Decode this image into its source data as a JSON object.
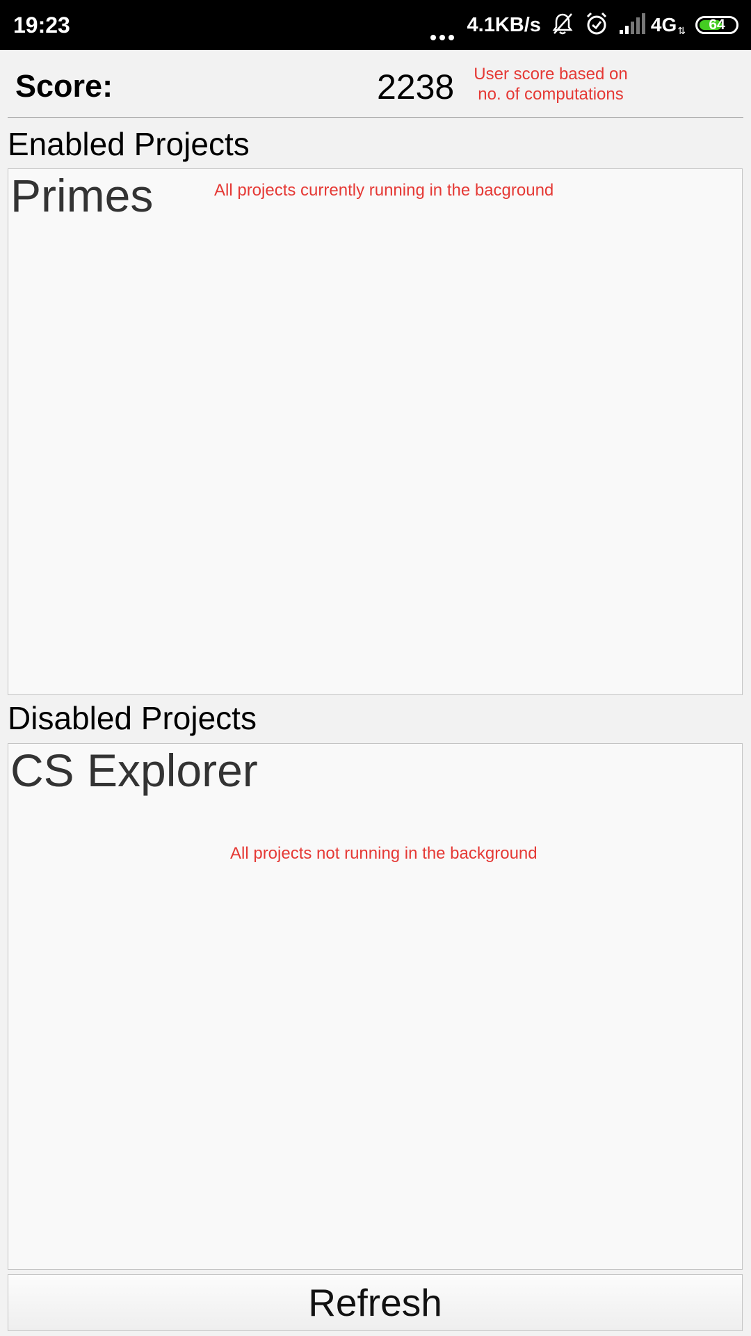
{
  "status_bar": {
    "time": "19:23",
    "network_speed": "4.1KB/s",
    "network_type": "4G",
    "network_activity": "⇅",
    "battery_level": 64,
    "battery_label": "64",
    "icons": [
      "more-dots-icon",
      "notifications-off-icon",
      "alarm-icon",
      "signal-icon",
      "battery-icon"
    ],
    "battery_color": "#44cc22"
  },
  "score": {
    "label": "Score:",
    "value": "2238",
    "note": "User score based on no. of computations"
  },
  "enabled_section": {
    "title": "Enabled Projects",
    "projects": [
      "Primes"
    ],
    "hint": "All projects currently running in the bacground"
  },
  "disabled_section": {
    "title": "Disabled Projects",
    "projects": [
      "CS Explorer"
    ],
    "hint": "All projects not running in the background"
  },
  "refresh_button": {
    "label": "Refresh"
  },
  "colors": {
    "hint_text": "#e53935",
    "background": "#f2f2f2",
    "list_background": "#f9f9f9"
  }
}
